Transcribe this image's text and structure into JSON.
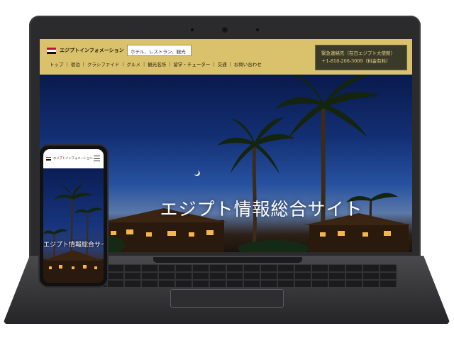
{
  "site": {
    "name": "エジプトインフォメーション",
    "search_placeholder": "ホテル、レストラン、観光",
    "nav": [
      "トップ",
      "宿泊",
      "クラシファイド",
      "グルメ",
      "観光名所",
      "留学・チューター",
      "交通",
      "お問い合わせ"
    ],
    "emergency_line1": "緊急連絡先（在日エジプト大使館）",
    "emergency_line2": "＋1-818-208-3009（料金有料）",
    "hero_title": "エジプト情報総合サイト"
  },
  "mobile": {
    "name": "エジプトインフォメーション",
    "hero_title": "エジプト情報総合サイト"
  },
  "colors": {
    "header_gold": "#d9c26b",
    "emergency_bg": "#3b3a28",
    "sky": "#132f74"
  },
  "icons": [
    "egypt-flag-icon",
    "hamburger-menu-icon",
    "crescent-moon-icon"
  ]
}
